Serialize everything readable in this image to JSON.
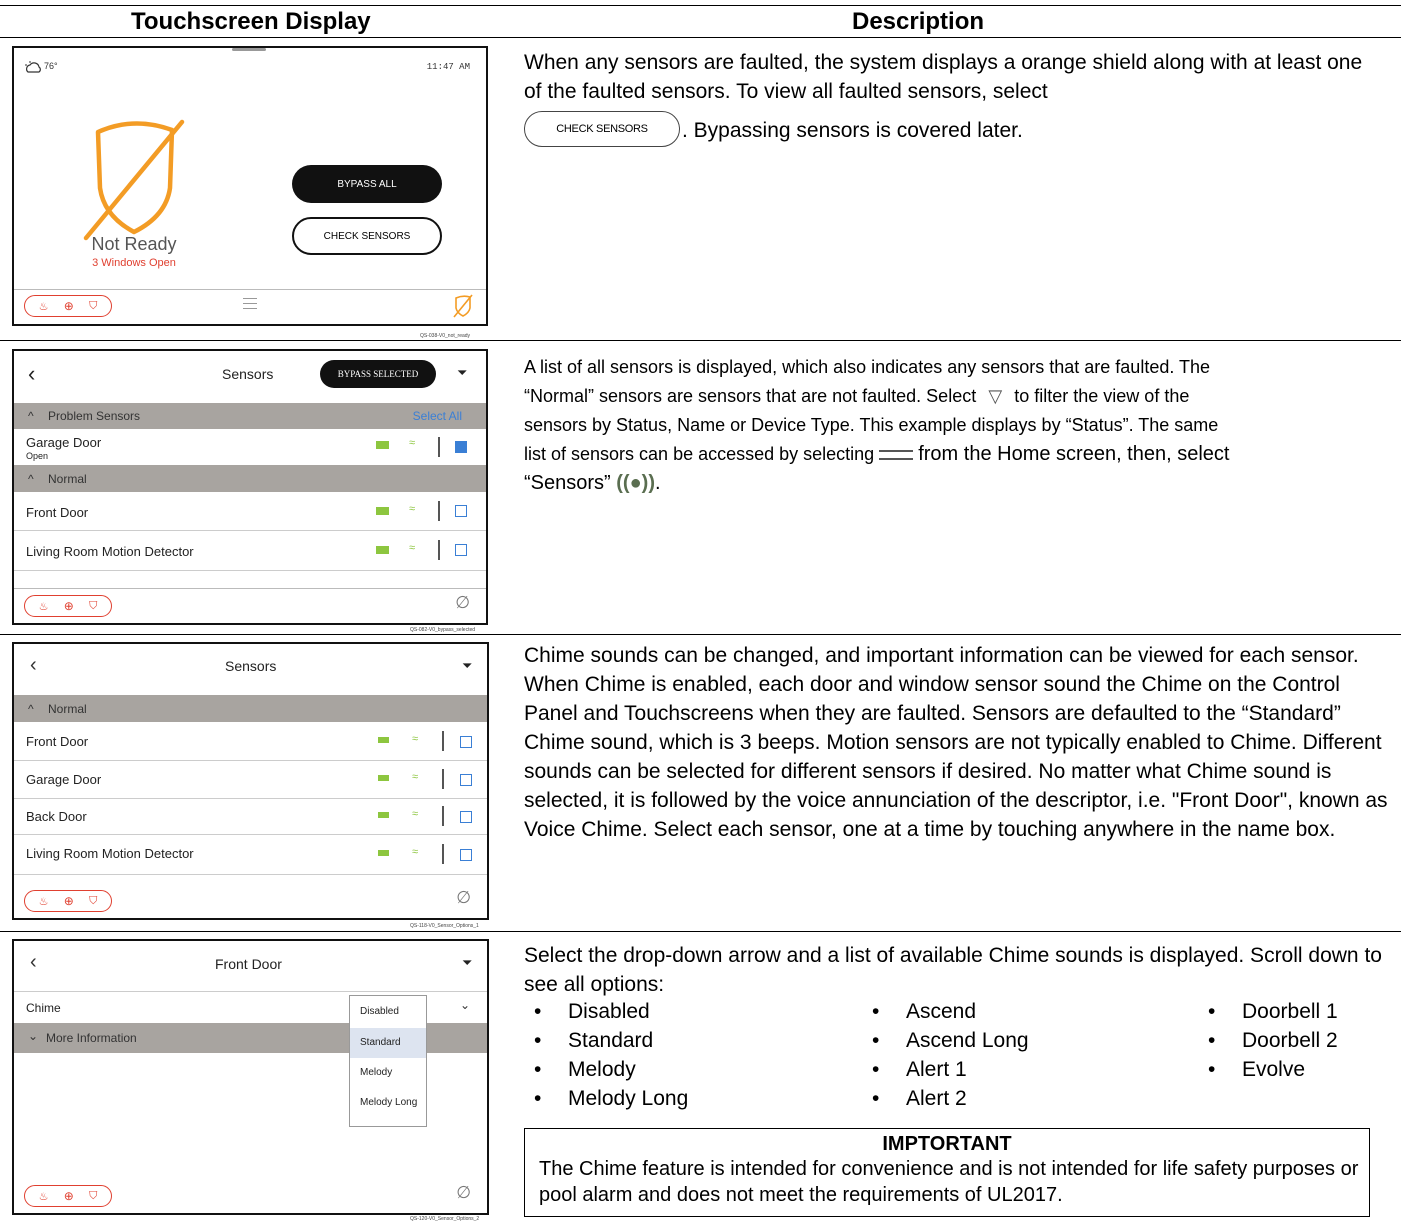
{
  "headers": {
    "left": "Touchscreen Display",
    "right": "Description"
  },
  "panel1": {
    "weather_temp": "76°",
    "time": "11:47 AM",
    "status": "Not Ready",
    "substatus": "3 Windows Open",
    "bypass_all": "BYPASS ALL",
    "check_sensors": "CHECK SENSORS",
    "image_id": "QS-038-V0_not_ready",
    "desc_a": "When any sensors are faulted, the system displays a orange shield along with at least one of the faulted sensors.  To view all faulted sensors, select",
    "inline_button": "CHECK SENSORS",
    "desc_b": ".  Bypassing sensors is covered later."
  },
  "panel2": {
    "title": "Sensors",
    "bypass_selected": "BYPASS SELECTED",
    "problem_header": "Problem Sensors",
    "select_all": "Select All",
    "garage_door": "Garage Door",
    "garage_status": "Open",
    "normal_header": "Normal",
    "front_door": "Front Door",
    "living_room": "Living Room Motion Detector",
    "image_id": "QS-082-V0_bypass_selected",
    "desc_1": "A list of all sensors is displayed, which also indicates any sensors that are faulted.  The",
    "desc_2a": "“Normal” sensors are sensors that are not faulted.  Select",
    "desc_2b": "to filter the view of the",
    "desc_3": "sensors by Status, Name or Device Type.  This example displays by “Status”.  The same",
    "desc_4a": "list of sensors can be accessed by selecting",
    "desc_4b": "from the Home screen, then, select",
    "desc_5a": "“Sensors”",
    "desc_5b": "."
  },
  "panel3": {
    "title": "Sensors",
    "normal_header": "Normal",
    "rows": [
      "Front Door",
      "Garage Door",
      "Back Door",
      "Living Room Motion Detector"
    ],
    "image_id": "QS-118-V0_Sensor_Options_1",
    "desc": "Chime sounds can be changed, and important information can be viewed for each sensor.  When Chime is enabled, each door and window sensor sound the Chime on the Control Panel and Touchscreens when they are faulted.  Sensors are defaulted to the “Standard” Chime sound, which is 3 beeps.  Motion sensors are not typically enabled to Chime.  Different sounds can be selected for different sensors if desired.  No matter what Chime sound is selected, it is followed by the voice annunciation of the descriptor, i.e. \"Front Door\", known as Voice Chime.  Select each sensor, one at a time by touching anywhere in the name box."
  },
  "panel4": {
    "title": "Front Door",
    "chime_label": "Chime",
    "more_info": "More Information",
    "dropdown": [
      "Disabled",
      "Standard",
      "Melody",
      "Melody Long"
    ],
    "image_id": "QS-120-V0_Sensor_Options_2",
    "desc": "Select the drop-down arrow and a list of available Chime sounds is displayed.  Scroll down to see all options:",
    "col1": [
      "Disabled",
      "Standard",
      "Melody",
      "Melody Long"
    ],
    "col2": [
      "Ascend",
      "Ascend Long",
      "Alert 1",
      "Alert 2"
    ],
    "col3": [
      "Doorbell 1",
      "Doorbell 2",
      "Evolve"
    ],
    "important_title": "IMPTORTANT",
    "important_text": "The Chime feature is intended for convenience and is not intended for life safety purposes or pool alarm and does not meet the requirements of UL2017."
  },
  "colors": {
    "orange": "#f39c25",
    "red": "#e04030",
    "blue": "#3a7fd5",
    "green": "#8dc63f",
    "gray_band": "#a8a4a0"
  }
}
